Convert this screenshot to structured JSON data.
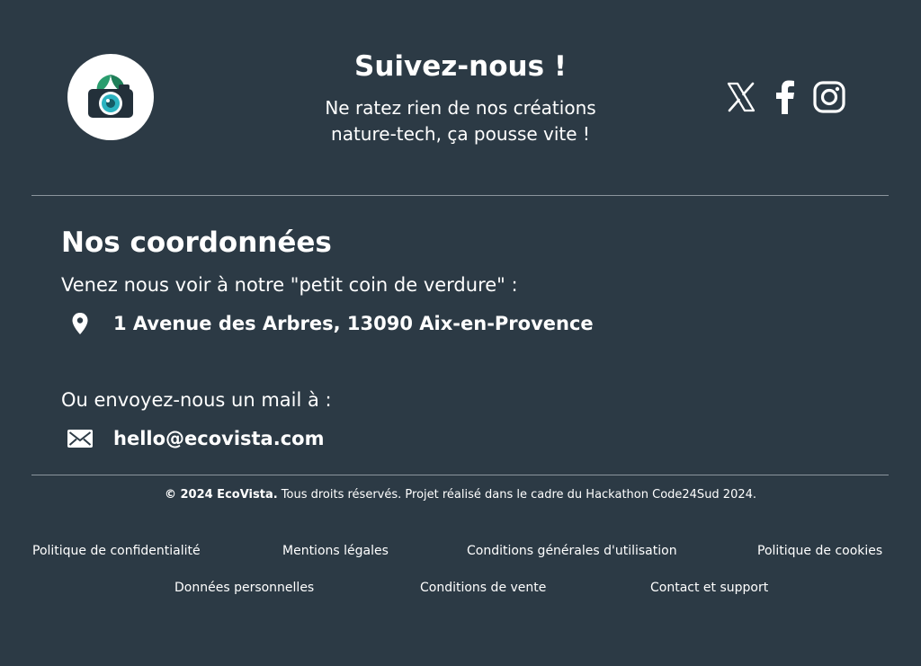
{
  "brand": {
    "logo_icon": "eco-camera-logo-icon",
    "accent_green": "#2a9d6e",
    "accent_teal": "#2bb3c0"
  },
  "follow": {
    "title": "Suivez-nous !",
    "subtitle": "Ne ratez rien de nos créations\nnature-tech, ça pousse vite !"
  },
  "socials": [
    {
      "icon": "x-twitter-icon"
    },
    {
      "icon": "facebook-icon"
    },
    {
      "icon": "instagram-icon"
    }
  ],
  "contact": {
    "title": "Nos coordonnées",
    "address_intro": "Venez nous voir à notre \"petit coin de verdure\" :",
    "address": "1 Avenue des Arbres, 13090 Aix-en-Provence",
    "mail_intro": "Ou envoyez-nous un mail à :",
    "email": "hello@ecovista.com"
  },
  "footer": {
    "copyright_bold": "© 2024 EcoVista.",
    "copyright_rest": " Tous droits réservés. Projet réalisé dans le cadre du Hackathon Code24Sud 2024.",
    "links_row1": [
      "Politique de confidentialité",
      "Mentions légales",
      "Conditions générales d'utilisation",
      "Politique de cookies"
    ],
    "links_row2": [
      "Données personnelles",
      "Conditions de vente",
      "Contact et support"
    ]
  },
  "colors": {
    "background": "#2c3a45",
    "divider": "#8b959d",
    "text": "#ffffff"
  }
}
